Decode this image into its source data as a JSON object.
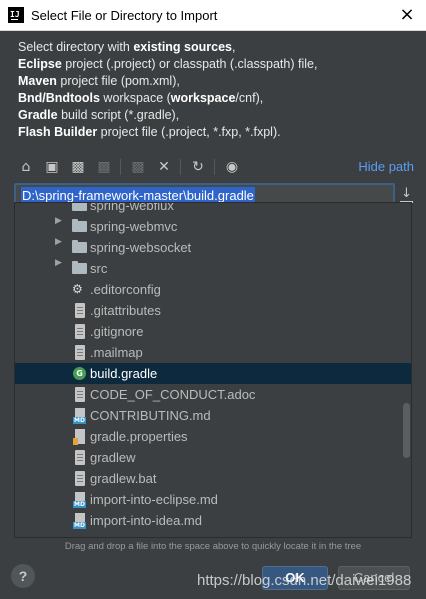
{
  "window": {
    "title": "Select File or Directory to Import",
    "logo_text": "IJ",
    "close_icon": "×"
  },
  "description": {
    "line1_pre": "Select directory with ",
    "line1_bold": "existing sources",
    "line1_post": ",",
    "line2_bold": "Eclipse",
    "line2_post": " project (.project) or classpath (.classpath) file,",
    "line3_bold": "Maven",
    "line3_post": " project file (pom.xml),",
    "line4_bold": "Bnd/Bndtools",
    "line4_mid": " workspace (",
    "line4_bold2": "workspace",
    "line4_post": "/cnf),",
    "line5_bold": "Gradle",
    "line5_post": " build script (*.gradle),",
    "line6_bold": "Flash Builder",
    "line6_post": " project file (.project, *.fxp, *.fxpl)."
  },
  "toolbar": {
    "home_icon": "home-icon",
    "desktop_icon": "desktop-icon",
    "project_icon": "project-folder-icon",
    "module_icon": "module-folder-icon",
    "new_folder_icon": "new-folder-icon",
    "delete_icon": "delete-icon",
    "refresh_icon": "refresh-icon",
    "show_hidden_icon": "show-hidden-icon",
    "hide_path_label": "Hide path"
  },
  "path": {
    "value": "D:\\spring-framework-master\\build.gradle"
  },
  "tree": {
    "rows": [
      {
        "label": "spring-webflux",
        "kind": "folder",
        "expandable": true
      },
      {
        "label": "spring-webmvc",
        "kind": "folder",
        "expandable": true
      },
      {
        "label": "spring-websocket",
        "kind": "folder",
        "expandable": true
      },
      {
        "label": "src",
        "kind": "folder",
        "expandable": true
      },
      {
        "label": ".editorconfig",
        "kind": "config"
      },
      {
        "label": ".gitattributes",
        "kind": "file"
      },
      {
        "label": ".gitignore",
        "kind": "file"
      },
      {
        "label": ".mailmap",
        "kind": "file"
      },
      {
        "label": "build.gradle",
        "kind": "gradle",
        "selected": true
      },
      {
        "label": "CODE_OF_CONDUCT.adoc",
        "kind": "file"
      },
      {
        "label": "CONTRIBUTING.md",
        "kind": "md"
      },
      {
        "label": "gradle.properties",
        "kind": "properties"
      },
      {
        "label": "gradlew",
        "kind": "file"
      },
      {
        "label": "gradlew.bat",
        "kind": "file"
      },
      {
        "label": "import-into-eclipse.md",
        "kind": "md"
      },
      {
        "label": "import-into-idea.md",
        "kind": "md"
      }
    ]
  },
  "hint": "Drag and drop a file into the space above to quickly locate it in the tree",
  "buttons": {
    "help": "?",
    "ok": "OK",
    "cancel": "Cancel"
  },
  "watermark": "https://blog.csdn.net/daiwei1988",
  "colors": {
    "background": "#3c3f41",
    "selection": "#0d293e",
    "link": "#589df6",
    "ok_button": "#365880"
  }
}
